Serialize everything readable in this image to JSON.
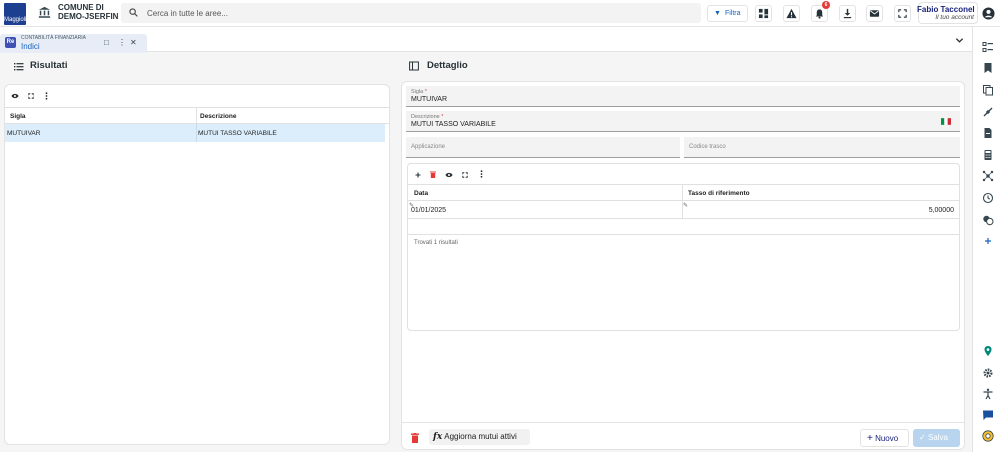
{
  "header": {
    "logo_text": "Maggioli",
    "comune_line1": "COMUNE DI",
    "comune_line2": "DEMO-JSERFIN",
    "search_placeholder": "Cerca in tutte le aree...",
    "filter_label": "Filtra",
    "notifications_count": "6",
    "user_name": "Fabio Tacconell...",
    "user_sub": "Il tuo account"
  },
  "tab": {
    "badge": "Re",
    "module": "CONTABILITÀ FINANZIARIA",
    "title": "Indici"
  },
  "results": {
    "heading": "Risultati",
    "columns": [
      "Sigla",
      "Descrizione"
    ],
    "rows": [
      {
        "sigla": "MUTUIVAR",
        "descrizione": "MUTUI TASSO VARIABILE"
      }
    ]
  },
  "detail": {
    "heading": "Dettaglio",
    "sigla_label": "Sigla",
    "sigla_value": "MUTUIVAR",
    "descrizione_label": "Descrizione",
    "descrizione_value": "MUTUI TASSO VARIABILE",
    "applicazione_placeholder": "Applicazione",
    "codice_trascodifica_placeholder": "Codice trasco",
    "grid": {
      "columns": [
        "Data",
        "Tasso di riferimento"
      ],
      "rows": [
        {
          "data": "01/01/2025",
          "tasso": "5,00000"
        }
      ],
      "footer": "Trovati 1 risultati"
    },
    "aggiorna_label": "Aggiorna mutui attivi",
    "nuovo_label": "Nuovo",
    "salva_label": "Salva"
  },
  "colors": {
    "brand": "#1d3f8f",
    "accent": "#1565c0",
    "delete": "#e53935",
    "selected_row": "#dceefb"
  },
  "icons": [
    "bank-icon",
    "search-icon",
    "filter-icon",
    "grid-icon",
    "warning-icon",
    "bell-icon",
    "download-icon",
    "mail-icon",
    "fullscreen-icon",
    "account-icon",
    "list-icon",
    "panel-icon",
    "eye-icon",
    "expand-icon",
    "more-icon",
    "plus-icon",
    "trash-icon",
    "italy-flag-icon",
    "function-icon",
    "check-icon"
  ]
}
